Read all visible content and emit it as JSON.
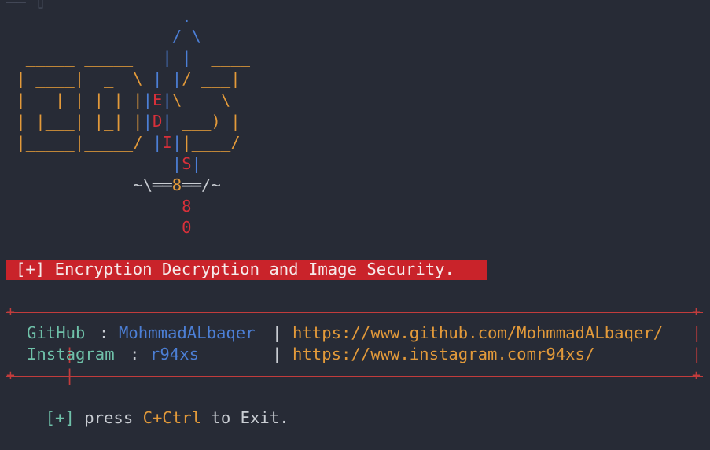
{
  "prompt_fragment": "── ▯",
  "logo": {
    "rows": [
      [
        {
          "t": "                  .",
          "c": "blue"
        }
      ],
      [
        {
          "t": "                 / \\",
          "c": "blue"
        }
      ],
      [
        {
          "t": "                 | |",
          "c": "blue"
        },
        {
          "t": " ____",
          "c": "orange"
        }
      ],
      [
        {
          "t": "  _____ _____ ",
          "c": "orange"
        }
      ],
      [
        {
          "t": " |  ___|  _  \\",
          "c": "orange"
        },
        {
          "t": " | |",
          "c": "blue"
        },
        {
          "t": "/ ___|",
          "c": "orange"
        }
      ],
      [
        {
          "t": " | |_  | | | |",
          "c": "orange"
        },
        {
          "t": "|",
          "c": "blue"
        },
        {
          "t": "E",
          "c": "red"
        },
        {
          "t": "|",
          "c": "blue"
        },
        {
          "t": "\\___ \\",
          "c": "orange"
        }
      ],
      [
        {
          "t": " |  _| | | | |",
          "c": "orange"
        },
        {
          "t": "|",
          "c": "blue"
        },
        {
          "t": "D",
          "c": "red"
        },
        {
          "t": "|",
          "c": "blue"
        },
        {
          "t": " ___) |",
          "c": "orange"
        }
      ],
      [
        {
          "t": " |_____|_____/",
          "c": "orange"
        },
        {
          "t": " |",
          "c": "blue"
        },
        {
          "t": "I",
          "c": "red"
        },
        {
          "t": "|",
          "c": "blue"
        },
        {
          "t": "|____/",
          "c": "orange"
        }
      ],
      [
        {
          "t": "                 |",
          "c": "blue"
        },
        {
          "t": "S",
          "c": "red"
        },
        {
          "t": "|",
          "c": "blue"
        }
      ],
      [
        {
          "t": "             ~\\==",
          "c": "gray"
        },
        {
          "t": "8",
          "c": "orange"
        },
        {
          "t": "==/~",
          "c": "gray"
        }
      ],
      [
        {
          "t": "                  8",
          "c": "red"
        }
      ],
      [
        {
          "t": "                  0",
          "c": "red"
        }
      ]
    ]
  },
  "banner": {
    "text": "[+] Encryption Decryption and Image Security."
  },
  "links": {
    "github": {
      "label": "GitHub",
      "colon": ":",
      "handle": "MohmmadALbaqer",
      "url": "https://www.github.com/MohmmadALbaqer/"
    },
    "instagram": {
      "label": "Instagram",
      "colon": ":",
      "handle": "r94xs",
      "url": "https://www.instagram.comr94xs/"
    }
  },
  "footer": {
    "prefix": "[+]",
    "word_press": "press",
    "keys": "C+Ctrl",
    "suffix": "to Exit."
  },
  "colors": {
    "background": "#272b36",
    "banner_bg": "#c9232a",
    "blue": "#4c7fd6",
    "orange": "#e39a3a",
    "red": "#d7303a",
    "teal": "#6fc1a9",
    "frame_red": "#c23c3c"
  }
}
